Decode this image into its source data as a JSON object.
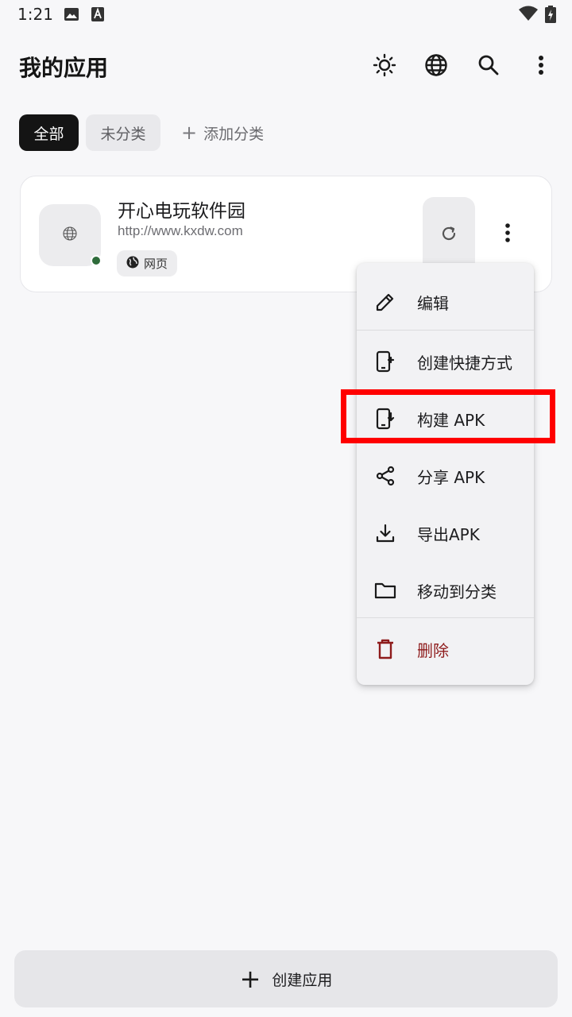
{
  "status_bar": {
    "time": "1:21",
    "icons": [
      "image-icon",
      "font-icon",
      "wifi-icon",
      "battery-charging-icon"
    ]
  },
  "header": {
    "title": "我的应用",
    "actions": [
      "brightness-icon",
      "globe-icon",
      "search-icon",
      "more-vert-icon"
    ]
  },
  "categories": {
    "all": "全部",
    "uncategorized": "未分类",
    "add": "添加分类",
    "selected": "全部"
  },
  "app_card": {
    "name": "开心电玩软件园",
    "url": "http://www.kxdw.com",
    "tag": "网页",
    "status_color": "#2e6b3a"
  },
  "menu": {
    "items": [
      {
        "label": "编辑",
        "icon": "edit-icon"
      },
      {
        "label": "创建快捷方式",
        "icon": "add-shortcut-icon"
      },
      {
        "label": "构建 APK",
        "icon": "build-apk-icon"
      },
      {
        "label": "分享 APK",
        "icon": "share-icon"
      },
      {
        "label": "导出APK",
        "icon": "download-icon"
      },
      {
        "label": "移动到分类",
        "icon": "folder-icon"
      },
      {
        "label": "删除",
        "icon": "delete-icon"
      }
    ],
    "highlighted": "构建 APK",
    "highlight_color": "#ff0000",
    "danger_color": "#8e1b1b"
  },
  "bottom": {
    "create_label": "创建应用"
  }
}
